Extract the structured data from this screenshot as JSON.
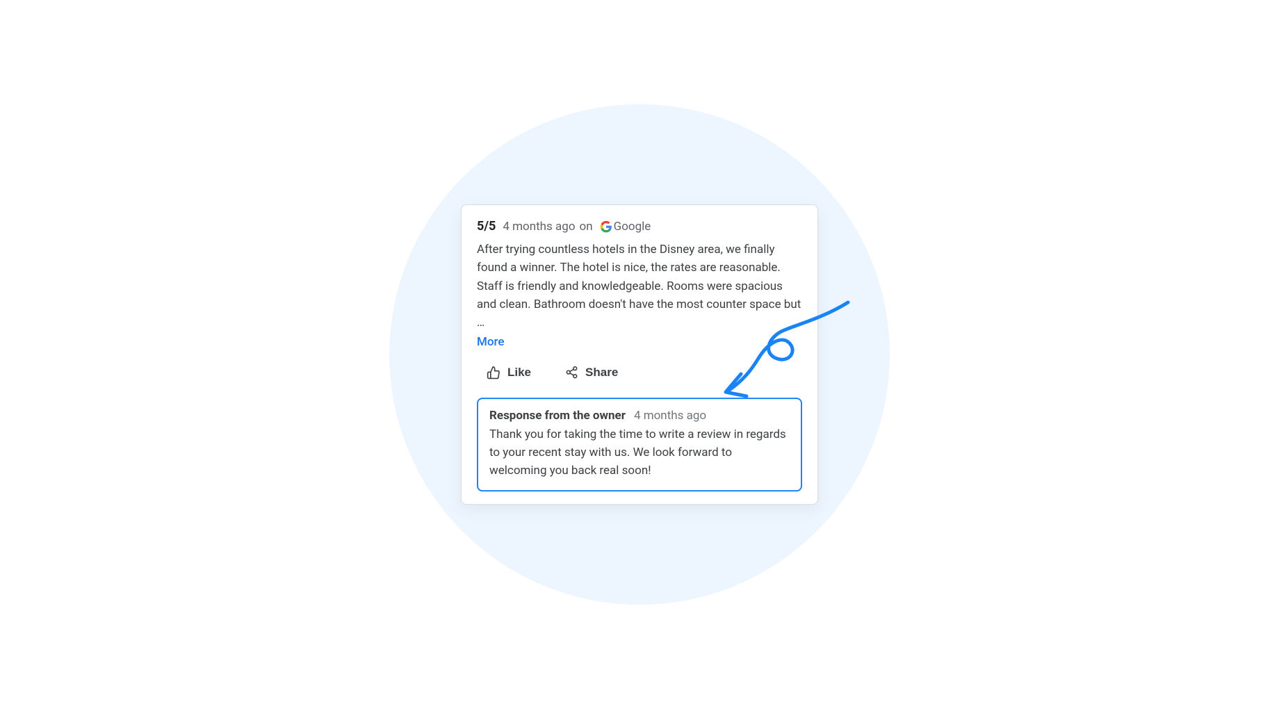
{
  "review": {
    "rating": "5/5",
    "timestamp": "4 months ago",
    "on_label": "on",
    "source_name": "Google",
    "body": "After trying countless hotels in the Disney area, we finally found a winner. The hotel is nice, the rates are reasonable. Staff is friendly and knowledgeable. Rooms were spacious and clean. Bathroom doesn't have the most counter space but …",
    "more_label": "More"
  },
  "actions": {
    "like_label": "Like",
    "share_label": "Share"
  },
  "owner_response": {
    "title": "Response from the owner",
    "timestamp": "4 months ago",
    "body": "Thank you for taking the time to write a review in regards to your recent stay with us. We look forward to welcoming you back real soon!"
  },
  "colors": {
    "accent": "#1a73e8",
    "highlight_border": "#1a83f7",
    "bg_circle": "#edf5ff"
  }
}
